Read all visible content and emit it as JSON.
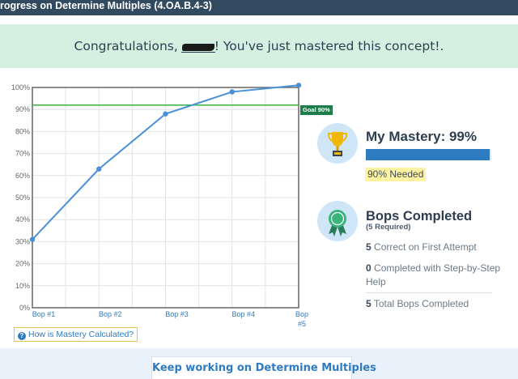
{
  "header": {
    "title": "rogress on Determine Multiples (4.OA.B.4-3)"
  },
  "banner": {
    "before": "Congratulations, ",
    "name": "",
    "after": "! You've just mastered this concept!."
  },
  "chart_data": {
    "type": "line",
    "categories": [
      "Bop #1",
      "Bop #2",
      "Bop #3",
      "Bop #4",
      "Bop #5"
    ],
    "series": [
      {
        "values": [
          31,
          63,
          88,
          98,
          101
        ]
      }
    ],
    "ylim": [
      0,
      100
    ],
    "yticks": [
      "0%",
      "10%",
      "20%",
      "30%",
      "40%",
      "50%",
      "60%",
      "70%",
      "80%",
      "90%",
      "100%"
    ],
    "goal": {
      "value": 92,
      "label": "Goal 90%"
    },
    "colors": {
      "line": "#4a90d9",
      "goal": "#3cb043"
    },
    "grid": true
  },
  "help_link": {
    "label": "How is Mastery Calculated?",
    "icon": "question-circle-icon"
  },
  "mastery": {
    "title": "My Mastery: 99%",
    "value": 99,
    "needed": "90% Needed",
    "icon": "trophy-icon"
  },
  "bops": {
    "title": "Bops Completed",
    "required": "(5 Required)",
    "icon": "ribbon-icon",
    "stats": [
      {
        "count": "5",
        "label": "Correct on First Attempt"
      },
      {
        "count": "0",
        "label": "Completed with Step-by-Step Help"
      },
      {
        "count": "5",
        "label": "Total Bops Completed"
      }
    ]
  },
  "footer": {
    "button_label": "Keep working on Determine Multiples"
  },
  "colors": {
    "accent": "#2f7bc2",
    "header": "#324a60",
    "banner": "#d4f0e0",
    "needed_highlight": "#fff2a0"
  }
}
